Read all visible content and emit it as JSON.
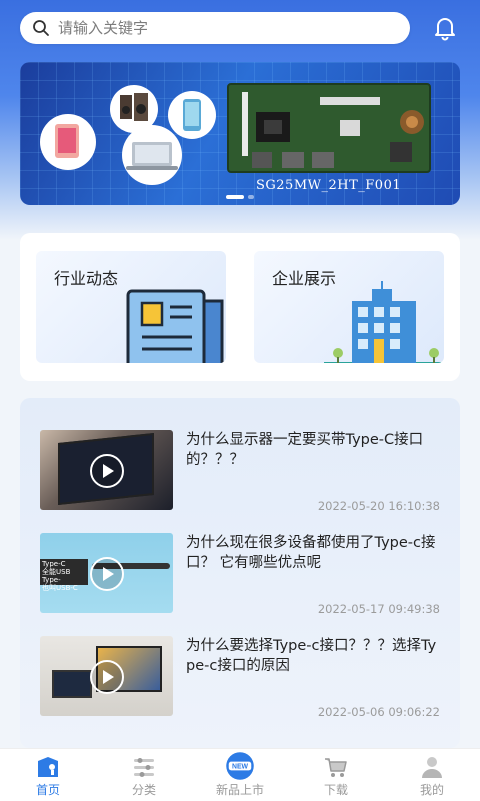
{
  "search": {
    "placeholder": "请输入关键字"
  },
  "banner": {
    "caption": "SG25MW_2HT_F001",
    "slide_count": 2,
    "active_slide": 1
  },
  "categories": [
    {
      "label": "行业动态"
    },
    {
      "label": "企业展示"
    }
  ],
  "news": [
    {
      "title": "为什么显示器一定要买带Type-C接口的？？？",
      "date": "2022-05-20 16:10:38"
    },
    {
      "title": "为什么现在很多设备都使用了Type-c接口？ 它有哪些优点呢",
      "date": "2022-05-17 09:49:38"
    },
    {
      "title": "为什么要选择Type-c接口？？？选择Type-c接口的原因",
      "date": "2022-05-06 09:06:22"
    }
  ],
  "thumb_text": {
    "line1": "Type-C",
    "line2": "全能USB Type-",
    "line3": "也叫USB-C"
  },
  "tabs": [
    {
      "label": "首页",
      "icon": "home-icon",
      "active": true
    },
    {
      "label": "分类",
      "icon": "category-icon",
      "active": false
    },
    {
      "label": "新品上市",
      "icon": "new-badge-icon",
      "active": false
    },
    {
      "label": "下载",
      "icon": "cart-icon",
      "active": false
    },
    {
      "label": "我的",
      "icon": "user-icon",
      "active": false
    }
  ],
  "new_badge_text": "NEW",
  "colors": {
    "accent": "#2d7be5",
    "tab_inactive": "#9a9a9a",
    "bg": "#f1f5fa"
  }
}
